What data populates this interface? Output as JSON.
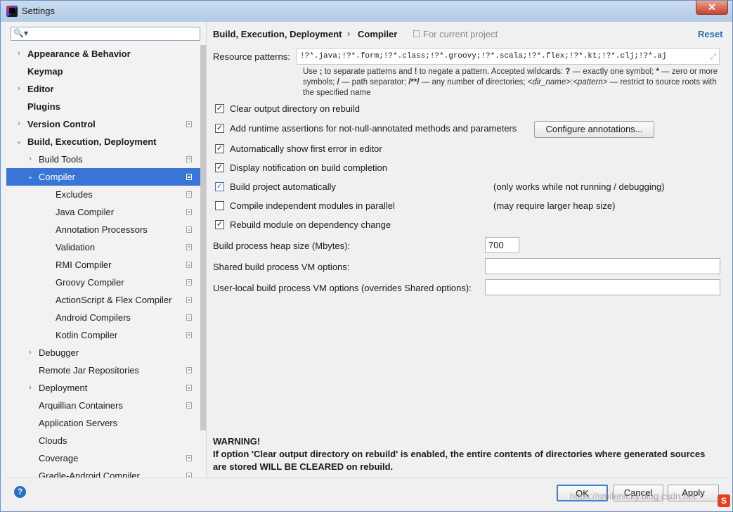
{
  "window": {
    "title": "Settings",
    "close": "✕"
  },
  "search": {
    "placeholder": ""
  },
  "tree": [
    {
      "label": "Appearance & Behavior",
      "arrow": "›",
      "bold": true,
      "indent": 0,
      "icon": false,
      "selected": false
    },
    {
      "label": "Keymap",
      "arrow": "",
      "bold": true,
      "indent": 0,
      "icon": false,
      "selected": false
    },
    {
      "label": "Editor",
      "arrow": "›",
      "bold": true,
      "indent": 0,
      "icon": false,
      "selected": false
    },
    {
      "label": "Plugins",
      "arrow": "",
      "bold": true,
      "indent": 0,
      "icon": false,
      "selected": false
    },
    {
      "label": "Version Control",
      "arrow": "›",
      "bold": true,
      "indent": 0,
      "icon": true,
      "selected": false
    },
    {
      "label": "Build, Execution, Deployment",
      "arrow": "⌄",
      "bold": true,
      "indent": 0,
      "icon": false,
      "selected": false
    },
    {
      "label": "Build Tools",
      "arrow": "›",
      "bold": false,
      "indent": 1,
      "icon": true,
      "selected": false
    },
    {
      "label": "Compiler",
      "arrow": "⌄",
      "bold": false,
      "indent": 1,
      "icon": true,
      "selected": true
    },
    {
      "label": "Excludes",
      "arrow": "",
      "bold": false,
      "indent": 2,
      "icon": true,
      "selected": false
    },
    {
      "label": "Java Compiler",
      "arrow": "",
      "bold": false,
      "indent": 2,
      "icon": true,
      "selected": false
    },
    {
      "label": "Annotation Processors",
      "arrow": "",
      "bold": false,
      "indent": 2,
      "icon": true,
      "selected": false
    },
    {
      "label": "Validation",
      "arrow": "",
      "bold": false,
      "indent": 2,
      "icon": true,
      "selected": false
    },
    {
      "label": "RMI Compiler",
      "arrow": "",
      "bold": false,
      "indent": 2,
      "icon": true,
      "selected": false
    },
    {
      "label": "Groovy Compiler",
      "arrow": "",
      "bold": false,
      "indent": 2,
      "icon": true,
      "selected": false
    },
    {
      "label": "ActionScript & Flex Compiler",
      "arrow": "",
      "bold": false,
      "indent": 2,
      "icon": true,
      "selected": false
    },
    {
      "label": "Android Compilers",
      "arrow": "",
      "bold": false,
      "indent": 2,
      "icon": true,
      "selected": false
    },
    {
      "label": "Kotlin Compiler",
      "arrow": "",
      "bold": false,
      "indent": 2,
      "icon": true,
      "selected": false
    },
    {
      "label": "Debugger",
      "arrow": "›",
      "bold": false,
      "indent": 1,
      "icon": false,
      "selected": false
    },
    {
      "label": "Remote Jar Repositories",
      "arrow": "",
      "bold": false,
      "indent": 1,
      "icon": true,
      "selected": false
    },
    {
      "label": "Deployment",
      "arrow": "›",
      "bold": false,
      "indent": 1,
      "icon": true,
      "selected": false
    },
    {
      "label": "Arquillian Containers",
      "arrow": "",
      "bold": false,
      "indent": 1,
      "icon": true,
      "selected": false
    },
    {
      "label": "Application Servers",
      "arrow": "",
      "bold": false,
      "indent": 1,
      "icon": false,
      "selected": false
    },
    {
      "label": "Clouds",
      "arrow": "",
      "bold": false,
      "indent": 1,
      "icon": false,
      "selected": false
    },
    {
      "label": "Coverage",
      "arrow": "",
      "bold": false,
      "indent": 1,
      "icon": true,
      "selected": false
    },
    {
      "label": "Gradle-Android Compiler",
      "arrow": "",
      "bold": false,
      "indent": 1,
      "icon": true,
      "selected": false
    }
  ],
  "header": {
    "breadcrumb_parent": "Build, Execution, Deployment",
    "separator": "›",
    "breadcrumb_current": "Compiler",
    "scope": "For current project",
    "reset": "Reset"
  },
  "resource": {
    "label": "Resource patterns:",
    "value": "!?*.java;!?*.form;!?*.class;!?*.groovy;!?*.scala;!?*.flex;!?*.kt;!?*.clj;!?*.aj",
    "help_line1_a": "Use ",
    "help_semi": ";",
    "help_line1_b": " to separate patterns and ",
    "help_bang": "!",
    "help_line1_c": " to negate a pattern. Accepted wildcards: ",
    "help_q": "?",
    "help_line1_d": " — exactly one symbol; ",
    "help_star": "*",
    "help_line1_e": " — zero or more symbols; ",
    "help_slash": "/",
    "help_line1_f": " — path separator; ",
    "help_dstar": "/**/",
    "help_line1_g": " — any number of directories; ",
    "help_dirname": "<dir_name>",
    "help_colon": ":",
    "help_pattern": "<pattern>",
    "help_line1_h": " — restrict to source roots with the specified name"
  },
  "options": [
    {
      "label": "Clear output directory on rebuild",
      "checked": true,
      "blue": false,
      "note": ""
    },
    {
      "label": "Add runtime assertions for not-null-annotated methods and parameters",
      "checked": true,
      "blue": false,
      "note": ""
    },
    {
      "label": "Automatically show first error in editor",
      "checked": true,
      "blue": false,
      "note": ""
    },
    {
      "label": "Display notification on build completion",
      "checked": true,
      "blue": false,
      "note": ""
    },
    {
      "label": "Build project automatically",
      "checked": true,
      "blue": true,
      "note": "(only works while not running / debugging)"
    },
    {
      "label": "Compile independent modules in parallel",
      "checked": false,
      "blue": false,
      "note": "(may require larger heap size)"
    },
    {
      "label": "Rebuild module on dependency change",
      "checked": true,
      "blue": false,
      "note": ""
    }
  ],
  "configure_button": "Configure annotations...",
  "heap": {
    "label": "Build process heap size (Mbytes):",
    "value": "700"
  },
  "shared_vm": {
    "label": "Shared build process VM options:",
    "value": ""
  },
  "user_vm": {
    "label": "User-local build process VM options (overrides Shared options):",
    "value": ""
  },
  "warning": {
    "title": "WARNING!",
    "text": "If option 'Clear output directory on rebuild' is enabled, the entire contents of directories where generated sources are stored WILL BE CLEARED on rebuild."
  },
  "footer": {
    "help": "?",
    "ok": "OK",
    "cancel": "Cancel",
    "apply": "Apply"
  },
  "watermark": "https://smilenicky.blog.csdn.net",
  "watermark_logo": "S",
  "colors": {
    "accent": "#3875d7",
    "link": "#2470b3"
  }
}
